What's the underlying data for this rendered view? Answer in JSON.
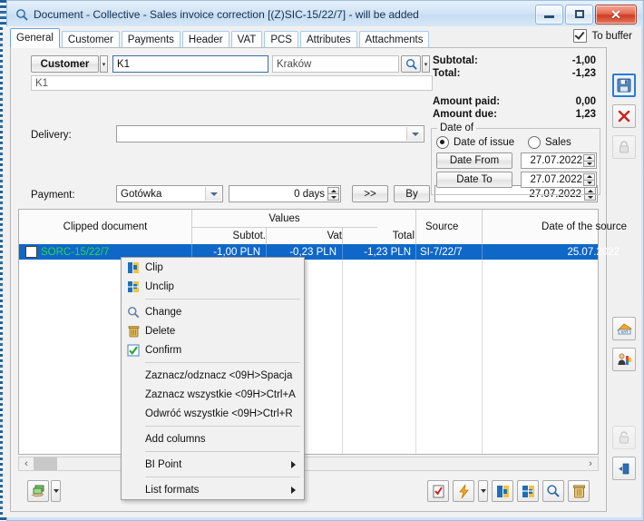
{
  "window": {
    "title": "Document - Collective - Sales invoice correction [(Z)SIC-15/22/7]  - will be added",
    "icon": "magnifier-icon",
    "minimize_label": "—",
    "maximize_label": "□",
    "close_label": "✕"
  },
  "tabs": [
    {
      "label": "General",
      "active": true
    },
    {
      "label": "Customer",
      "active": false
    },
    {
      "label": "Payments",
      "active": false
    },
    {
      "label": "Header",
      "active": false
    },
    {
      "label": "VAT",
      "active": false
    },
    {
      "label": "PCS",
      "active": false
    },
    {
      "label": "Attributes",
      "active": false
    },
    {
      "label": "Attachments",
      "active": false
    }
  ],
  "to_buffer": {
    "label": "To buffer",
    "checked": true
  },
  "form": {
    "customer_button": "Customer",
    "customer_dropdown_caret": "▾",
    "customer_code": "K1",
    "customer_city": "Kraków",
    "search_icon": "magnifier-icon",
    "search_caret": "▾",
    "customer_name": "K1",
    "delivery_label": "Delivery:",
    "delivery_value": "",
    "payment_label": "Payment:",
    "payment_method": "Gotówka",
    "payment_days": "0 days",
    "forward_button": ">>",
    "by_button": "By",
    "by_date": "27.07.2022"
  },
  "totals": [
    {
      "label": "Subtotal:",
      "value": "-1,00"
    },
    {
      "label": "Total:",
      "value": "-1,23"
    },
    {
      "label": "Amount paid:",
      "value": "0,00"
    },
    {
      "label": "Amount due:",
      "value": "1,23"
    }
  ],
  "date_of": {
    "group_title": "Date of",
    "option_issue": "Date of issue",
    "option_sales": "Sales",
    "selected": "issue",
    "date_from_label": "Date From",
    "date_from_value": "27.07.2022",
    "date_to_label": "Date To",
    "date_to_value": "27.07.2022"
  },
  "grid": {
    "headers": {
      "clipped_document": "Clipped document",
      "values_group": "Values",
      "subtotal": "Subtot.",
      "vat": "Vat",
      "total": "Total",
      "source": "Source",
      "date_of_source": "Date of the source"
    },
    "rows": [
      {
        "checked": false,
        "document": "SORC-15/22/7",
        "subtotal": "-1,00 PLN",
        "vat": "-0,23 PLN",
        "total": "-1,23 PLN",
        "source": "SI-7/22/7",
        "date_of_source": "25.07.2022"
      }
    ],
    "hscroll": {
      "left_arrow": "‹",
      "right_arrow": "›"
    }
  },
  "context_menu": [
    {
      "label": "Clip",
      "icon": "clip-icon",
      "submenu": false,
      "separator_after": false
    },
    {
      "label": "Unclip",
      "icon": "unclip-icon",
      "submenu": false,
      "separator_after": true
    },
    {
      "label": "Change",
      "icon": "magnifier-icon",
      "submenu": false,
      "separator_after": false
    },
    {
      "label": "Delete",
      "icon": "trash-icon",
      "submenu": false,
      "separator_after": false
    },
    {
      "label": "Confirm",
      "icon": "checkmark-icon",
      "submenu": false,
      "separator_after": true
    },
    {
      "label": "Zaznacz/odznacz <09H>Spacja",
      "icon": "",
      "submenu": false,
      "separator_after": false
    },
    {
      "label": "Zaznacz wszystkie <09H>Ctrl+A",
      "icon": "",
      "submenu": false,
      "separator_after": false
    },
    {
      "label": "Odwróć wszystkie <09H>Ctrl+R",
      "icon": "",
      "submenu": false,
      "separator_after": true
    },
    {
      "label": "Add columns",
      "icon": "",
      "submenu": false,
      "separator_after": true
    },
    {
      "label": "BI Point",
      "icon": "",
      "submenu": true,
      "separator_after": true
    },
    {
      "label": "List formats",
      "icon": "",
      "submenu": true,
      "separator_after": false
    }
  ],
  "bottom_toolbar": {
    "left": [
      {
        "icon": "money-hand-icon",
        "name": "payment-button"
      },
      {
        "icon": "caret-down-icon",
        "name": "payment-dropdown"
      }
    ],
    "right": [
      {
        "icon": "checklist-icon",
        "name": "confirm-button"
      },
      {
        "icon": "lightning-icon",
        "name": "generate-button"
      },
      {
        "icon": "caret-down-icon",
        "name": "generate-dropdown"
      },
      {
        "icon": "clip-icon",
        "name": "clip-button"
      },
      {
        "icon": "unclip-icon",
        "name": "unclip-button"
      },
      {
        "icon": "magnifier-icon",
        "name": "preview-button"
      },
      {
        "icon": "trash-icon",
        "name": "delete-button"
      }
    ]
  },
  "rail": [
    {
      "icon": "save-icon",
      "name": "save-button",
      "state": "selected"
    },
    {
      "icon": "close-x-icon",
      "name": "cancel-button",
      "state": "normal"
    },
    {
      "icon": "padlock-icon",
      "name": "lock-button",
      "state": "disabled"
    },
    {
      "icon": "vat-icon",
      "name": "vat-button",
      "state": "normal"
    },
    {
      "icon": "contractor-icon",
      "name": "contractor-button",
      "state": "normal"
    },
    {
      "icon": "unlock-icon",
      "name": "unlock-button",
      "state": "disabled"
    },
    {
      "icon": "pin-icon",
      "name": "pin-button",
      "state": "normal"
    }
  ],
  "colors": {
    "accent": "#0f67c8",
    "title_text": "#15314f",
    "row_doc_text": "#22c55e",
    "close_btn": "#cf3c25"
  }
}
